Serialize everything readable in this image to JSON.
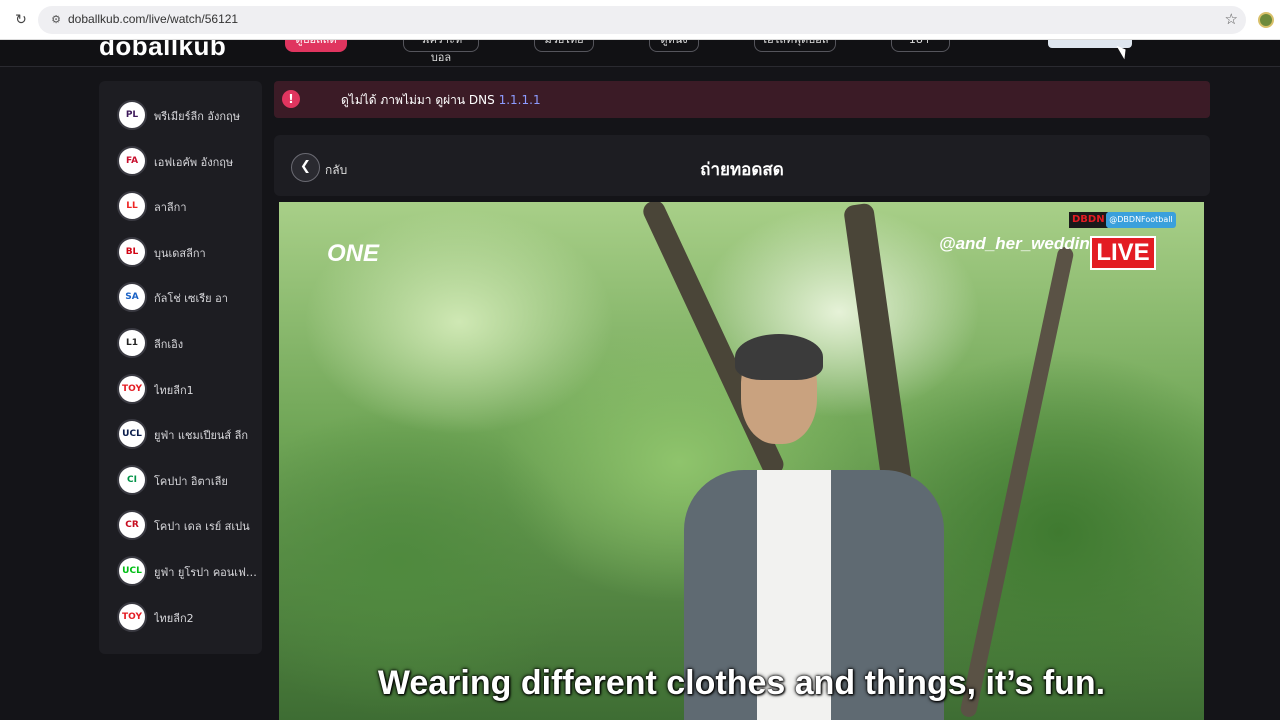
{
  "browser": {
    "url": "doballkub.com/live/watch/56121"
  },
  "header": {
    "logo": "doballkub",
    "nav": [
      "ดูบอลสด",
      "วิเคราะห์บอล",
      "มวยไทย",
      "ดูหนัง",
      "ไฮไลท์ฟุตบอล",
      "18+"
    ]
  },
  "sidebar": {
    "leagues": [
      {
        "name": "พรีเมียร์ลีก อังกฤษ",
        "badge": "PL",
        "color": "#3d195b"
      },
      {
        "name": "เอฟเอคัพ อังกฤษ",
        "badge": "FA",
        "color": "#c8102e"
      },
      {
        "name": "ลาลีกา",
        "badge": "LL",
        "color": "#ee2523"
      },
      {
        "name": "บุนเดสลีกา",
        "badge": "BL",
        "color": "#d20515"
      },
      {
        "name": "กัลโช่ เซเรีย อา",
        "badge": "SA",
        "color": "#1a62c5"
      },
      {
        "name": "ลีกเอิง",
        "badge": "L1",
        "color": "#222222"
      },
      {
        "name": "ไทยลีก1",
        "badge": "TOY",
        "color": "#e31c23"
      },
      {
        "name": "ยูฟ่า แชมเปียนส์ ลีก",
        "badge": "UCL",
        "color": "#0b1e4d"
      },
      {
        "name": "โคปปา อิตาเลีย",
        "badge": "CI",
        "color": "#009246"
      },
      {
        "name": "โคปา เดล เรย์ สเปน",
        "badge": "CR",
        "color": "#c60b1e"
      },
      {
        "name": "ยูฟ่า ยูโรปา คอนเฟอเรนซ์ ลีก",
        "badge": "UCL",
        "color": "#00be14"
      },
      {
        "name": "ไทยลีก2",
        "badge": "TOY",
        "color": "#e31c23"
      }
    ]
  },
  "alert": {
    "icon": "exclamation-icon",
    "message": "ดูไม่ได้ ภาพไม่มา ดูผ่าน DNS",
    "dns": "1.1.1.1"
  },
  "titlebar": {
    "back_label": "กลับ",
    "title": "ถ่ายทอดสด"
  },
  "video": {
    "brand_logo": "ONE",
    "overlay_tag": "DBDN",
    "telegram": "@DBDNFootball",
    "handle": "@and_her_weddin",
    "live_badge": "LIVE",
    "subtitle": "Wearing different clothes and things, it’s fun."
  }
}
